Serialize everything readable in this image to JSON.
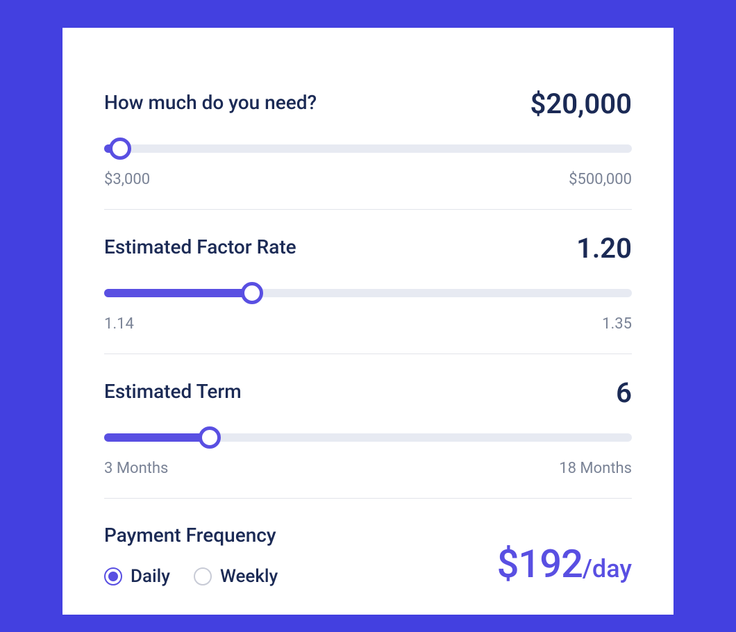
{
  "colors": {
    "background": "#4340e0",
    "accent": "#594fe2",
    "text_dark": "#1b2a55",
    "text_muted": "#7a8396",
    "track": "#e7eaf2"
  },
  "amount": {
    "label": "How much do you need?",
    "value_display": "$20,000",
    "min_label": "$3,000",
    "max_label": "$500,000",
    "fill_percent": 3,
    "thumb_percent": 3
  },
  "factor_rate": {
    "label": "Estimated Factor Rate",
    "value_display": "1.20",
    "min_label": "1.14",
    "max_label": "1.35",
    "fill_percent": 28,
    "thumb_percent": 28
  },
  "term": {
    "label": "Estimated Term",
    "value_display": "6",
    "min_label": "3 Months",
    "max_label": "18 Months",
    "fill_percent": 20,
    "thumb_percent": 20
  },
  "payment_frequency": {
    "label": "Payment Frequency",
    "options": [
      {
        "label": "Daily",
        "selected": true
      },
      {
        "label": "Weekly",
        "selected": false
      }
    ]
  },
  "payment_result": {
    "amount": "$192",
    "period": "/day"
  }
}
